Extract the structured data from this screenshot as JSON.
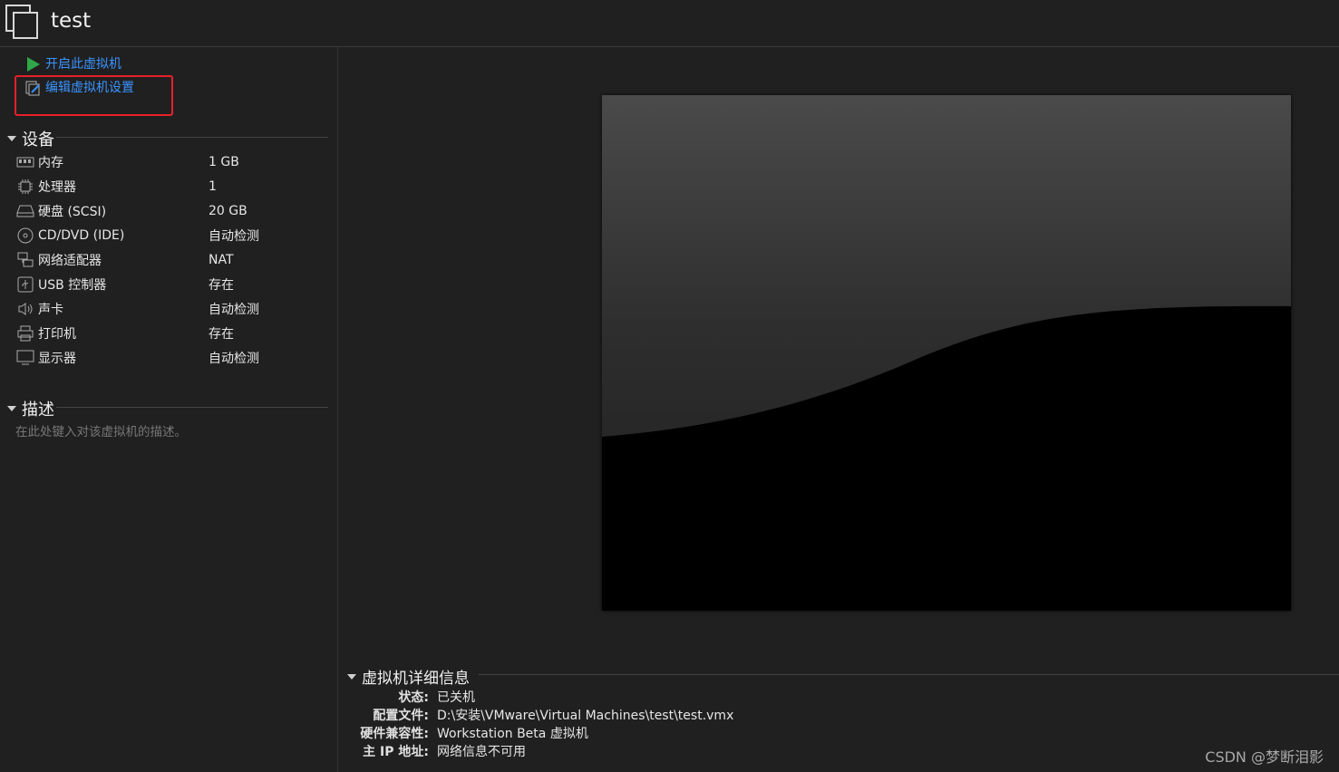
{
  "header": {
    "title": "test",
    "icon": "vm-window-icon"
  },
  "actions": [
    {
      "label": "开启此虚拟机",
      "icon": "play-icon",
      "color": "#2fa84a"
    },
    {
      "label": "编辑虚拟机设置",
      "icon": "edit-settings-icon"
    }
  ],
  "devices": {
    "heading": "设备",
    "items": [
      {
        "name": "内存",
        "value": "1 GB",
        "icon": "memory-icon"
      },
      {
        "name": "处理器",
        "value": "1",
        "icon": "cpu-icon"
      },
      {
        "name": "硬盘 (SCSI)",
        "value": "20 GB",
        "icon": "hard-disk-icon"
      },
      {
        "name": "CD/DVD (IDE)",
        "value": "自动检测",
        "icon": "cd-dvd-icon"
      },
      {
        "name": "网络适配器",
        "value": "NAT",
        "icon": "network-adapter-icon"
      },
      {
        "name": "USB 控制器",
        "value": "存在",
        "icon": "usb-icon"
      },
      {
        "name": "声卡",
        "value": "自动检测",
        "icon": "speaker-icon"
      },
      {
        "name": "打印机",
        "value": "存在",
        "icon": "printer-icon"
      },
      {
        "name": "显示器",
        "value": "自动检测",
        "icon": "monitor-icon"
      }
    ]
  },
  "description": {
    "heading": "描述",
    "placeholder": "在此处键入对该虚拟机的描述。"
  },
  "details": {
    "heading": "虚拟机详细信息",
    "rows": [
      {
        "key": "状态:",
        "value": "已关机"
      },
      {
        "key": "配置文件:",
        "value": "D:\\安装\\VMware\\Virtual Machines\\test\\test.vmx"
      },
      {
        "key": "硬件兼容性:",
        "value": "Workstation Beta 虚拟机"
      },
      {
        "key": "主 IP 地址:",
        "value": "网络信息不可用"
      }
    ]
  },
  "watermark": "CSDN @梦断泪影",
  "colors": {
    "link": "#3a93ff",
    "highlight_border": "#e8202a",
    "background": "#202020"
  }
}
